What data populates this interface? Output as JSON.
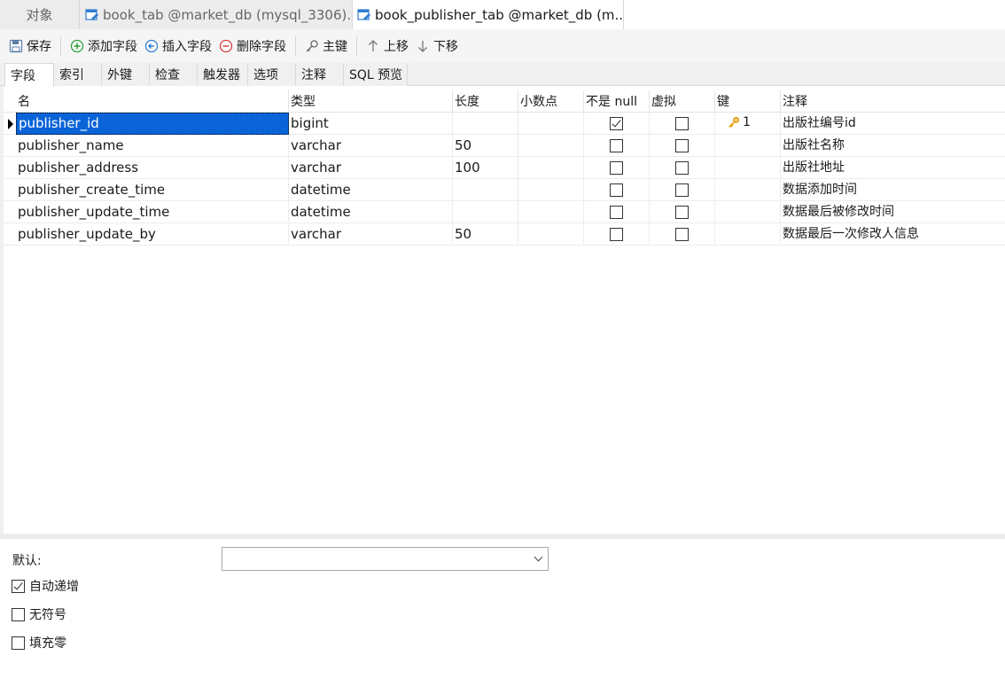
{
  "doc_tabs": [
    {
      "label": "对象"
    },
    {
      "label": "book_tab @market_db (mysql_3306)..."
    },
    {
      "label": "book_publisher_tab @market_db (m..."
    }
  ],
  "toolbar": {
    "save": "保存",
    "add_field": "添加字段",
    "insert_field": "插入字段",
    "delete_field": "删除字段",
    "primary_key": "主键",
    "move_up": "上移",
    "move_down": "下移"
  },
  "sub_tabs": [
    "字段",
    "索引",
    "外键",
    "检查",
    "触发器",
    "选项",
    "注释",
    "SQL 预览"
  ],
  "columns": [
    "名",
    "类型",
    "长度",
    "小数点",
    "不是 null",
    "虚拟",
    "键",
    "注释"
  ],
  "rows": [
    {
      "name": "publisher_id",
      "type": "bigint",
      "length": "",
      "decimals": "",
      "not_null": true,
      "virtual": false,
      "key": "1",
      "comment": "出版社编号id"
    },
    {
      "name": "publisher_name",
      "type": "varchar",
      "length": "50",
      "decimals": "",
      "not_null": false,
      "virtual": false,
      "key": "",
      "comment": "出版社名称"
    },
    {
      "name": "publisher_address",
      "type": "varchar",
      "length": "100",
      "decimals": "",
      "not_null": false,
      "virtual": false,
      "key": "",
      "comment": "出版社地址"
    },
    {
      "name": "publisher_create_time",
      "type": "datetime",
      "length": "",
      "decimals": "",
      "not_null": false,
      "virtual": false,
      "key": "",
      "comment": "数据添加时间"
    },
    {
      "name": "publisher_update_time",
      "type": "datetime",
      "length": "",
      "decimals": "",
      "not_null": false,
      "virtual": false,
      "key": "",
      "comment": "数据最后被修改时间"
    },
    {
      "name": "publisher_update_by",
      "type": "varchar",
      "length": "50",
      "decimals": "",
      "not_null": false,
      "virtual": false,
      "key": "",
      "comment": "数据最后一次修改人信息"
    }
  ],
  "bottom": {
    "default_label": "默认:",
    "default_value": "",
    "auto_increment": {
      "label": "自动递增",
      "checked": true
    },
    "unsigned": {
      "label": "无符号",
      "checked": false
    },
    "zerofill": {
      "label": "填充零",
      "checked": false
    }
  },
  "colors": {
    "selection": "#0a64d8",
    "key_icon": "#e8a317",
    "add_icon": "#2e9d3a",
    "delete_icon": "#d84040",
    "tab_icon": "#2f7fd1"
  }
}
